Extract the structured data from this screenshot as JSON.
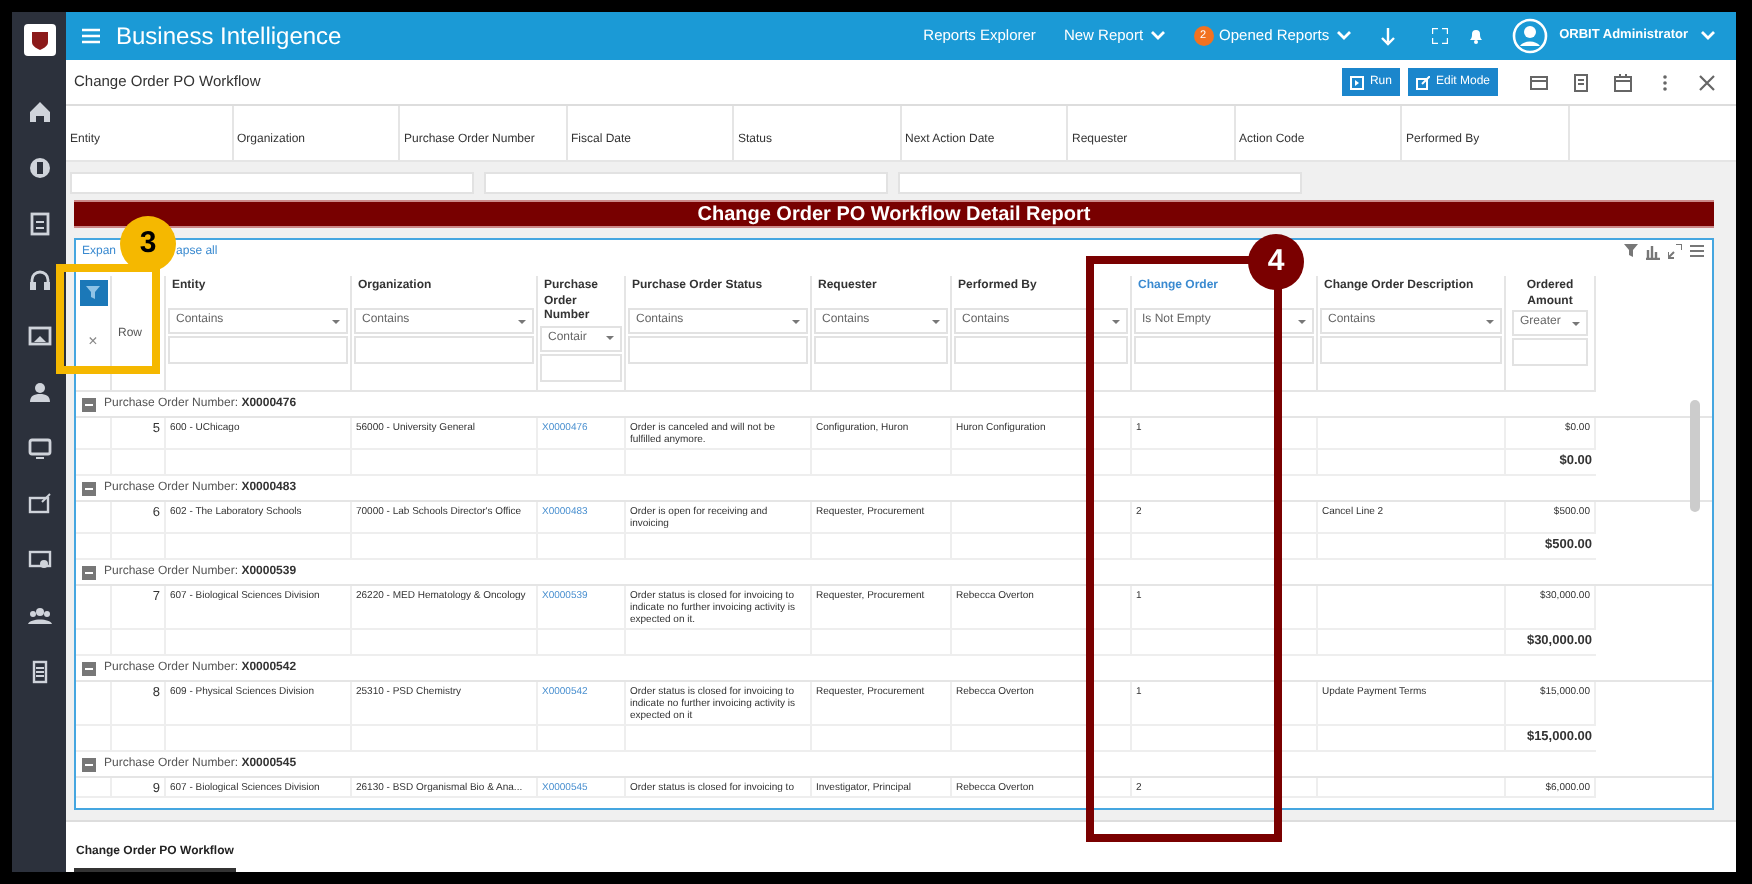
{
  "app": {
    "title": "Business Intelligence",
    "nav": [
      {
        "label": "Reports Explorer",
        "dropdown": false
      },
      {
        "label": "New Report",
        "dropdown": true
      },
      {
        "label": "Opened Reports",
        "dropdown": true,
        "badge": "2"
      }
    ],
    "user": "ORBIT Administrator"
  },
  "report": {
    "title": "Change Order PO Workflow",
    "buttons": [
      {
        "label": "Run",
        "kind": "run"
      },
      {
        "label": "Edit Mode",
        "kind": "edit"
      }
    ]
  },
  "parameters": [
    "Entity",
    "Organization",
    "Purchase Order Number",
    "Fiscal Date",
    "Status",
    "Next Action Date",
    "Requester",
    "Action Code",
    "Performed By"
  ],
  "banner": "Change Order PO Workflow Detail Report",
  "grid": {
    "expand_links": [
      "Expan",
      "apse all"
    ],
    "clear_filter": "×",
    "columns": [
      {
        "label": "Row",
        "kind": "row"
      },
      {
        "label": "Entity",
        "filter": "Contains",
        "active": false,
        "kind": "text"
      },
      {
        "label": "Organization",
        "filter": "Contains",
        "active": false,
        "kind": "text"
      },
      {
        "label": "Purchase Order Number",
        "filter": "Contair",
        "active": false,
        "kind": "text"
      },
      {
        "label": "Purchase Order Status",
        "filter": "Contains",
        "active": false,
        "kind": "text"
      },
      {
        "label": "Requester",
        "filter": "Contains",
        "active": false,
        "kind": "text"
      },
      {
        "label": "Performed By",
        "filter": "Contains",
        "active": false,
        "kind": "text"
      },
      {
        "label": "Change Order",
        "filter": "Is Not Empty",
        "active": true,
        "kind": "text"
      },
      {
        "label": "Change Order Description",
        "filter": "Contains",
        "active": false,
        "kind": "text"
      },
      {
        "label": "Ordered Amount",
        "filter": "Greater",
        "active": false,
        "kind": "amount"
      }
    ],
    "groups": [
      {
        "label": "Purchase Order Number:",
        "value": "X0000476",
        "expanded": true,
        "rows": [
          {
            "row": "5",
            "entity": "600 - UChicago",
            "organization": "56000 - University General",
            "po": "X0000476",
            "status": "Order is canceled and will not be fulfilled anymore.",
            "requester": "Configuration, Huron",
            "performed_by": "Huron Configuration",
            "change_order": "1",
            "amount": "$0.00"
          }
        ],
        "subtotal": "$0.00"
      },
      {
        "label": "Purchase Order Number:",
        "value": "X0000483",
        "expanded": true,
        "rows": [
          {
            "row": "6",
            "entity": "602 - The Laboratory Schools",
            "organization": "70000 - Lab Schools Director's Office",
            "po": "X0000483",
            "status": "Order is open for receiving and invoicing",
            "requester": "Requester, Procurement",
            "change_order": "2",
            "description": "Cancel Line 2",
            "amount": "$500.00"
          }
        ],
        "subtotal": "$500.00"
      },
      {
        "label": "Purchase Order Number:",
        "value": "X0000539",
        "expanded": true,
        "rows": [
          {
            "row": "7",
            "entity": "607 - Biological Sciences Division",
            "organization": "26220 - MED Hematology & Oncology",
            "po": "X0000539",
            "status": "Order status is closed for invoicing to indicate no further invoicing activity is expected on it.",
            "requester": "Requester, Procurement",
            "performed_by": "Rebecca Overton",
            "change_order": "1",
            "amount": "$30,000.00"
          }
        ],
        "subtotal": "$30,000.00"
      },
      {
        "label": "Purchase Order Number:",
        "value": "X0000542",
        "expanded": true,
        "rows": [
          {
            "row": "8",
            "entity": "609 - Physical Sciences Division",
            "organization": "25310 - PSD Chemistry",
            "po": "X0000542",
            "status": "Order status is closed for invoicing to indicate no further invoicing activity is expected on it",
            "requester": "Requester, Procurement",
            "performed_by": "Rebecca Overton",
            "change_order": "1",
            "description": "Update Payment Terms",
            "amount": "$15,000.00"
          }
        ],
        "subtotal": "$15,000.00"
      },
      {
        "label": "Purchase Order Number:",
        "value": "X0000545",
        "expanded": true,
        "rows": [
          {
            "row": "9",
            "entity": "607 - Biological Sciences Division",
            "organization": "26130 - BSD Organismal Bio & Ana...",
            "po": "X0000545",
            "status": "Order status is closed for invoicing to",
            "requester": "Investigator, Principal",
            "performed_by": "Rebecca Overton",
            "change_order": "2",
            "amount": "$6,000.00"
          }
        ]
      }
    ]
  },
  "annotations": [
    {
      "label": "3",
      "kind": "yellow"
    },
    {
      "label": "4",
      "kind": "red"
    }
  ],
  "tabs": [
    {
      "label": "Change Order PO Workflow",
      "selected": true
    }
  ]
}
